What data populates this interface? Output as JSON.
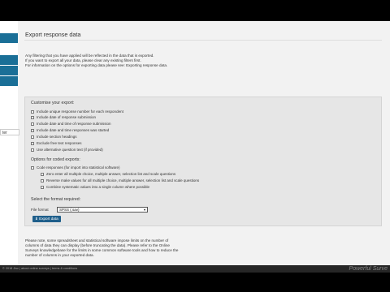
{
  "header": {
    "title": "Export response data"
  },
  "intro": {
    "lines": [
      "Any filtering that you have applied will be reflected in the data that is exported.",
      "If you want to export all your data, please clear any existing filters first.",
      "For information on the options for exporting data please see: Exporting response data."
    ]
  },
  "customise": {
    "title": "Customise your export:",
    "options": [
      "Include unique response number for each respondent",
      "Include date of response submission",
      "Include date and time of response submission",
      "Include date and time responses was started",
      "Include section headings",
      "Exclude free text responses",
      "Use alternative question text (if provided)"
    ]
  },
  "coded": {
    "title": "Options for coded exports:",
    "main_option": "Code responses (for import into statistical software)",
    "sub_options": [
      "Zero enter all multiple choice, multiple answer, selection list and scale questions",
      "Reverse make values for all multiple choice, multiple answer, selection list and scale questions",
      "Combine systematic values into a single column where possible"
    ]
  },
  "format": {
    "title": "Select the format required:",
    "label": "File format",
    "selected": "SPSS (.sav)",
    "export_button": "Export data"
  },
  "note": {
    "lines": [
      "Please note, some spreadsheet and statistical software impose limits on the number of",
      "columns of data they can display (before truncating the data). Please refer to the Online",
      "Surveys knowledgebase for the limits in some common software tools and how to reduce the",
      "number of columns in your exported data."
    ]
  },
  "sidebar": {
    "tab_label": "ter"
  },
  "footer": {
    "text": "© 2018 Jisc  |  about online surveys  |  terms & conditions",
    "brand": "Powerful Surve"
  }
}
